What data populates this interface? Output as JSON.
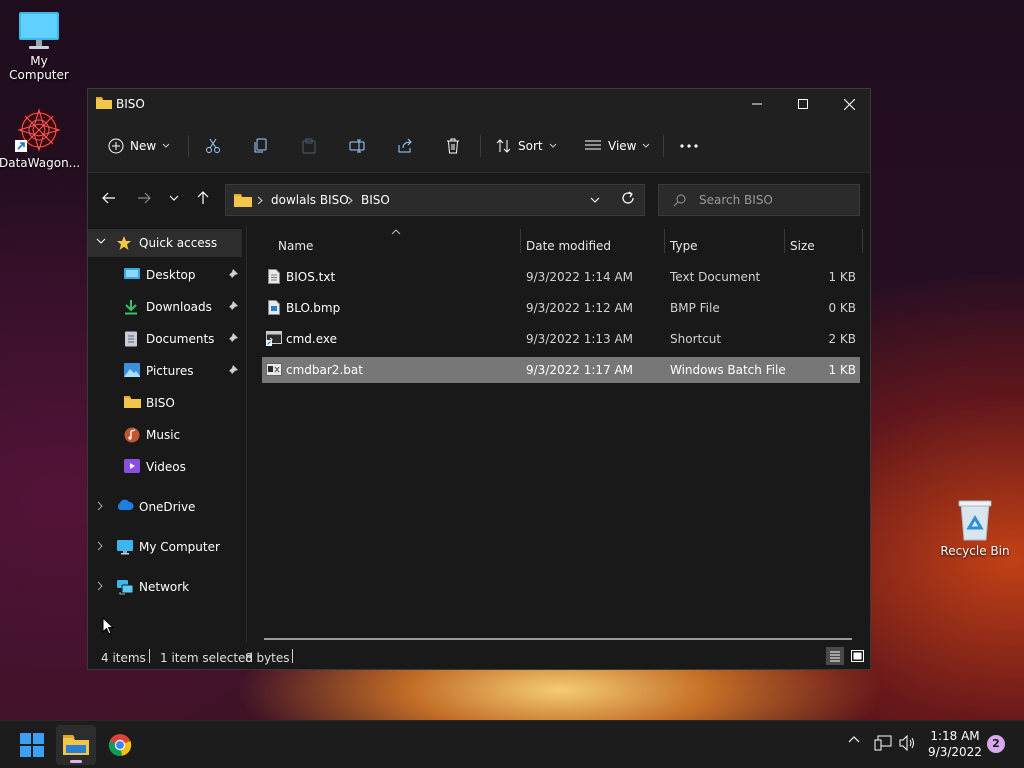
{
  "desktop": {
    "icons": [
      {
        "label": "My Computer"
      },
      {
        "label": "DataWagon..."
      },
      {
        "label": "Recycle Bin"
      }
    ]
  },
  "window": {
    "title": "BISO",
    "commandbar": {
      "new_label": "New",
      "sort_label": "Sort",
      "view_label": "View"
    },
    "address": {
      "segments": [
        "dowlals BISO",
        "BISO"
      ],
      "search_placeholder": "Search BISO"
    },
    "nav": {
      "quick_access": "Quick access",
      "pinned": [
        {
          "label": "Desktop"
        },
        {
          "label": "Downloads"
        },
        {
          "label": "Documents"
        },
        {
          "label": "Pictures"
        }
      ],
      "recent": [
        {
          "label": "BISO"
        },
        {
          "label": "Music"
        },
        {
          "label": "Videos"
        }
      ],
      "onedrive": "OneDrive",
      "my_computer": "My Computer",
      "network": "Network"
    },
    "columns": {
      "name": "Name",
      "date": "Date modified",
      "type": "Type",
      "size": "Size"
    },
    "files": [
      {
        "name": "BIOS.txt",
        "date": "9/3/2022 1:14 AM",
        "type": "Text Document",
        "size": "1 KB",
        "icon": "text-file-icon"
      },
      {
        "name": "BLO.bmp",
        "date": "9/3/2022 1:12 AM",
        "type": "BMP File",
        "size": "0 KB",
        "icon": "image-file-icon"
      },
      {
        "name": "cmd.exe",
        "date": "9/3/2022 1:13 AM",
        "type": "Shortcut",
        "size": "2 KB",
        "icon": "shortcut-icon"
      },
      {
        "name": "cmdbar2.bat",
        "date": "9/3/2022 1:17 AM",
        "type": "Windows Batch File",
        "size": "1 KB",
        "icon": "batch-file-icon",
        "selected": true
      }
    ],
    "status": {
      "count": "4 items",
      "selection": "1 item selected",
      "size": "8 bytes"
    }
  },
  "taskbar": {
    "time": "1:18 AM",
    "date": "9/3/2022",
    "notifications": "2"
  },
  "colors": {
    "window_bg": "#191919",
    "selection": "#777777",
    "folder": "#f3c54b",
    "accent": "#ddb1f0"
  }
}
